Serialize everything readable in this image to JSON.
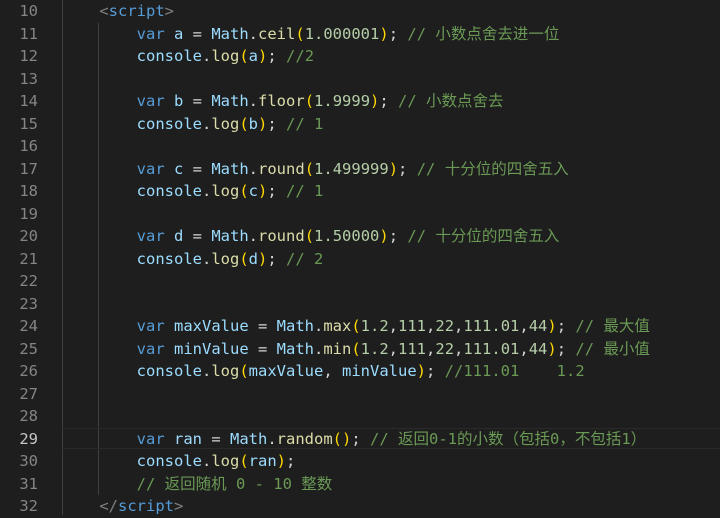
{
  "editor": {
    "lines": [
      {
        "num": "10",
        "indent": "    ",
        "tokens": [
          {
            "t": "<",
            "c": "punct"
          },
          {
            "t": "script",
            "c": "tag"
          },
          {
            "t": ">",
            "c": "punct"
          }
        ]
      },
      {
        "num": "11",
        "indent": "        ",
        "tokens": [
          {
            "t": "var",
            "c": "kw"
          },
          {
            "t": " ",
            "c": "plain"
          },
          {
            "t": "a",
            "c": "id"
          },
          {
            "t": " = ",
            "c": "op"
          },
          {
            "t": "Math",
            "c": "id"
          },
          {
            "t": ".",
            "c": "plain"
          },
          {
            "t": "ceil",
            "c": "fn"
          },
          {
            "t": "(",
            "c": "p1"
          },
          {
            "t": "1.000001",
            "c": "num"
          },
          {
            "t": ")",
            "c": "p1"
          },
          {
            "t": "; ",
            "c": "plain"
          },
          {
            "t": "// 小数点舍去进一位",
            "c": "cm"
          }
        ]
      },
      {
        "num": "12",
        "indent": "        ",
        "tokens": [
          {
            "t": "console",
            "c": "id"
          },
          {
            "t": ".",
            "c": "plain"
          },
          {
            "t": "log",
            "c": "fn"
          },
          {
            "t": "(",
            "c": "p1"
          },
          {
            "t": "a",
            "c": "id"
          },
          {
            "t": ")",
            "c": "p1"
          },
          {
            "t": "; ",
            "c": "plain"
          },
          {
            "t": "//2",
            "c": "cm"
          }
        ]
      },
      {
        "num": "13",
        "indent": "",
        "tokens": []
      },
      {
        "num": "14",
        "indent": "        ",
        "tokens": [
          {
            "t": "var",
            "c": "kw"
          },
          {
            "t": " ",
            "c": "plain"
          },
          {
            "t": "b",
            "c": "id"
          },
          {
            "t": " = ",
            "c": "op"
          },
          {
            "t": "Math",
            "c": "id"
          },
          {
            "t": ".",
            "c": "plain"
          },
          {
            "t": "floor",
            "c": "fn"
          },
          {
            "t": "(",
            "c": "p1"
          },
          {
            "t": "1.9999",
            "c": "num"
          },
          {
            "t": ")",
            "c": "p1"
          },
          {
            "t": "; ",
            "c": "plain"
          },
          {
            "t": "// 小数点舍去",
            "c": "cm"
          }
        ]
      },
      {
        "num": "15",
        "indent": "        ",
        "tokens": [
          {
            "t": "console",
            "c": "id"
          },
          {
            "t": ".",
            "c": "plain"
          },
          {
            "t": "log",
            "c": "fn"
          },
          {
            "t": "(",
            "c": "p1"
          },
          {
            "t": "b",
            "c": "id"
          },
          {
            "t": ")",
            "c": "p1"
          },
          {
            "t": "; ",
            "c": "plain"
          },
          {
            "t": "// 1",
            "c": "cm"
          }
        ]
      },
      {
        "num": "16",
        "indent": "",
        "tokens": []
      },
      {
        "num": "17",
        "indent": "        ",
        "tokens": [
          {
            "t": "var",
            "c": "kw"
          },
          {
            "t": " ",
            "c": "plain"
          },
          {
            "t": "c",
            "c": "id"
          },
          {
            "t": " = ",
            "c": "op"
          },
          {
            "t": "Math",
            "c": "id"
          },
          {
            "t": ".",
            "c": "plain"
          },
          {
            "t": "round",
            "c": "fn"
          },
          {
            "t": "(",
            "c": "p1"
          },
          {
            "t": "1.499999",
            "c": "num"
          },
          {
            "t": ")",
            "c": "p1"
          },
          {
            "t": "; ",
            "c": "plain"
          },
          {
            "t": "// 十分位的四舍五入",
            "c": "cm"
          }
        ]
      },
      {
        "num": "18",
        "indent": "        ",
        "tokens": [
          {
            "t": "console",
            "c": "id"
          },
          {
            "t": ".",
            "c": "plain"
          },
          {
            "t": "log",
            "c": "fn"
          },
          {
            "t": "(",
            "c": "p1"
          },
          {
            "t": "c",
            "c": "id"
          },
          {
            "t": ")",
            "c": "p1"
          },
          {
            "t": "; ",
            "c": "plain"
          },
          {
            "t": "// 1",
            "c": "cm"
          }
        ]
      },
      {
        "num": "19",
        "indent": "",
        "tokens": []
      },
      {
        "num": "20",
        "indent": "        ",
        "tokens": [
          {
            "t": "var",
            "c": "kw"
          },
          {
            "t": " ",
            "c": "plain"
          },
          {
            "t": "d",
            "c": "id"
          },
          {
            "t": " = ",
            "c": "op"
          },
          {
            "t": "Math",
            "c": "id"
          },
          {
            "t": ".",
            "c": "plain"
          },
          {
            "t": "round",
            "c": "fn"
          },
          {
            "t": "(",
            "c": "p1"
          },
          {
            "t": "1.50000",
            "c": "num"
          },
          {
            "t": ")",
            "c": "p1"
          },
          {
            "t": "; ",
            "c": "plain"
          },
          {
            "t": "// 十分位的四舍五入",
            "c": "cm"
          }
        ]
      },
      {
        "num": "21",
        "indent": "        ",
        "tokens": [
          {
            "t": "console",
            "c": "id"
          },
          {
            "t": ".",
            "c": "plain"
          },
          {
            "t": "log",
            "c": "fn"
          },
          {
            "t": "(",
            "c": "p1"
          },
          {
            "t": "d",
            "c": "id"
          },
          {
            "t": ")",
            "c": "p1"
          },
          {
            "t": "; ",
            "c": "plain"
          },
          {
            "t": "// 2",
            "c": "cm"
          }
        ]
      },
      {
        "num": "22",
        "indent": "",
        "tokens": []
      },
      {
        "num": "23",
        "indent": "",
        "tokens": []
      },
      {
        "num": "24",
        "indent": "        ",
        "tokens": [
          {
            "t": "var",
            "c": "kw"
          },
          {
            "t": " ",
            "c": "plain"
          },
          {
            "t": "maxValue",
            "c": "id"
          },
          {
            "t": " = ",
            "c": "op"
          },
          {
            "t": "Math",
            "c": "id"
          },
          {
            "t": ".",
            "c": "plain"
          },
          {
            "t": "max",
            "c": "fn"
          },
          {
            "t": "(",
            "c": "p1"
          },
          {
            "t": "1.2",
            "c": "num"
          },
          {
            "t": ",",
            "c": "plain"
          },
          {
            "t": "111",
            "c": "num"
          },
          {
            "t": ",",
            "c": "plain"
          },
          {
            "t": "22",
            "c": "num"
          },
          {
            "t": ",",
            "c": "plain"
          },
          {
            "t": "111.01",
            "c": "num"
          },
          {
            "t": ",",
            "c": "plain"
          },
          {
            "t": "44",
            "c": "num"
          },
          {
            "t": ")",
            "c": "p1"
          },
          {
            "t": "; ",
            "c": "plain"
          },
          {
            "t": "// 最大值",
            "c": "cm"
          }
        ]
      },
      {
        "num": "25",
        "indent": "        ",
        "tokens": [
          {
            "t": "var",
            "c": "kw"
          },
          {
            "t": " ",
            "c": "plain"
          },
          {
            "t": "minValue",
            "c": "id"
          },
          {
            "t": " = ",
            "c": "op"
          },
          {
            "t": "Math",
            "c": "id"
          },
          {
            "t": ".",
            "c": "plain"
          },
          {
            "t": "min",
            "c": "fn"
          },
          {
            "t": "(",
            "c": "p1"
          },
          {
            "t": "1.2",
            "c": "num"
          },
          {
            "t": ",",
            "c": "plain"
          },
          {
            "t": "111",
            "c": "num"
          },
          {
            "t": ",",
            "c": "plain"
          },
          {
            "t": "22",
            "c": "num"
          },
          {
            "t": ",",
            "c": "plain"
          },
          {
            "t": "111.01",
            "c": "num"
          },
          {
            "t": ",",
            "c": "plain"
          },
          {
            "t": "44",
            "c": "num"
          },
          {
            "t": ")",
            "c": "p1"
          },
          {
            "t": "; ",
            "c": "plain"
          },
          {
            "t": "// 最小值",
            "c": "cm"
          }
        ]
      },
      {
        "num": "26",
        "indent": "        ",
        "tokens": [
          {
            "t": "console",
            "c": "id"
          },
          {
            "t": ".",
            "c": "plain"
          },
          {
            "t": "log",
            "c": "fn"
          },
          {
            "t": "(",
            "c": "p1"
          },
          {
            "t": "maxValue",
            "c": "id"
          },
          {
            "t": ", ",
            "c": "plain"
          },
          {
            "t": "minValue",
            "c": "id"
          },
          {
            "t": ")",
            "c": "p1"
          },
          {
            "t": "; ",
            "c": "plain"
          },
          {
            "t": "//111.01    1.2",
            "c": "cm"
          }
        ]
      },
      {
        "num": "27",
        "indent": "",
        "tokens": []
      },
      {
        "num": "28",
        "indent": "",
        "tokens": []
      },
      {
        "num": "29",
        "indent": "        ",
        "current": true,
        "tokens": [
          {
            "t": "var",
            "c": "kw"
          },
          {
            "t": " ",
            "c": "plain"
          },
          {
            "t": "ran",
            "c": "id"
          },
          {
            "t": " = ",
            "c": "op"
          },
          {
            "t": "Math",
            "c": "id"
          },
          {
            "t": ".",
            "c": "plain"
          },
          {
            "t": "random",
            "c": "fn"
          },
          {
            "t": "()",
            "c": "p1"
          },
          {
            "t": "; ",
            "c": "plain"
          },
          {
            "t": "// 返回0-1的小数（包括0，不包括1）",
            "c": "cm"
          }
        ]
      },
      {
        "num": "30",
        "indent": "        ",
        "tokens": [
          {
            "t": "console",
            "c": "id"
          },
          {
            "t": ".",
            "c": "plain"
          },
          {
            "t": "log",
            "c": "fn"
          },
          {
            "t": "(",
            "c": "p1"
          },
          {
            "t": "ran",
            "c": "id"
          },
          {
            "t": ")",
            "c": "p1"
          },
          {
            "t": ";",
            "c": "plain"
          }
        ]
      },
      {
        "num": "31",
        "indent": "        ",
        "tokens": [
          {
            "t": "// 返回随机 0 - 10 整数",
            "c": "cm"
          }
        ]
      },
      {
        "num": "32",
        "indent": "    ",
        "tokens": [
          {
            "t": "</",
            "c": "punct"
          },
          {
            "t": "script",
            "c": "tag"
          },
          {
            "t": ">",
            "c": "punct"
          }
        ]
      }
    ]
  }
}
